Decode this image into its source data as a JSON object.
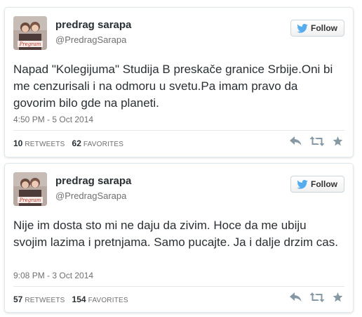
{
  "colors": {
    "twitter_blue": "#55acee",
    "icon_gray": "#8899a6",
    "border": "#e1e8ed"
  },
  "icons": [
    "bird-icon",
    "reply-icon",
    "retweet-icon",
    "favorite-icon"
  ],
  "tweets": [
    {
      "author_name": "predrag sarapa",
      "author_handle": "@PredragSarapa",
      "follow_label": "Follow",
      "text": "Napad \"Kolegijuma\" Studija B preskače granice Srbije.Oni bi me cenzurisali i na odmoru u svetu.Pa imam pravo da govorim bilo gde na planeti.",
      "timestamp": "4:50 PM - 5 Oct 2014",
      "retweets_count": "10",
      "retweets_label": "RETWEETS",
      "favorites_count": "62",
      "favorites_label": "FAVORITES"
    },
    {
      "author_name": "predrag sarapa",
      "author_handle": "@PredragSarapa",
      "follow_label": "Follow",
      "text": "Nije im dosta sto mi ne daju da zivim. Hoce da me ubiju svojim lazima i pretnjama. Samo pucajte. Ja i dalje drzim cas.",
      "timestamp": "9:08 PM - 3 Oct 2014",
      "retweets_count": "57",
      "retweets_label": "RETWEETS",
      "favorites_count": "154",
      "favorites_label": "FAVORITES"
    }
  ]
}
